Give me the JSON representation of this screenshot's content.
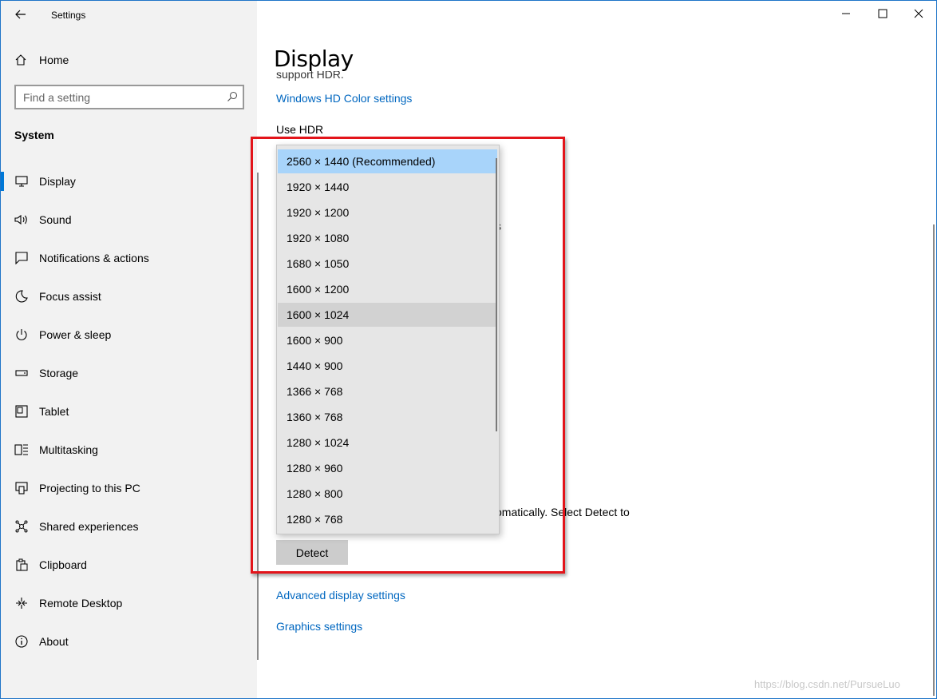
{
  "window": {
    "app_title": "Settings",
    "controls": [
      "minimize-icon",
      "maximize-icon",
      "close-icon"
    ]
  },
  "sidebar": {
    "home_label": "Home",
    "search_placeholder": "Find a setting",
    "section_title": "System",
    "items": [
      {
        "label": "Display",
        "icon": "monitor-icon",
        "active": true
      },
      {
        "label": "Sound",
        "icon": "speaker-icon"
      },
      {
        "label": "Notifications & actions",
        "icon": "notification-icon"
      },
      {
        "label": "Focus assist",
        "icon": "moon-icon"
      },
      {
        "label": "Power & sleep",
        "icon": "power-icon"
      },
      {
        "label": "Storage",
        "icon": "storage-icon"
      },
      {
        "label": "Tablet",
        "icon": "tablet-icon"
      },
      {
        "label": "Multitasking",
        "icon": "multitasking-icon"
      },
      {
        "label": "Projecting to this PC",
        "icon": "projecting-icon"
      },
      {
        "label": "Shared experiences",
        "icon": "shared-icon"
      },
      {
        "label": "Clipboard",
        "icon": "clipboard-icon"
      },
      {
        "label": "Remote Desktop",
        "icon": "remote-desktop-icon"
      },
      {
        "label": "About",
        "icon": "info-icon"
      }
    ]
  },
  "main": {
    "page_title": "Display",
    "clipped_text": "support HDR.",
    "hd_color_link": "Windows HD Color settings",
    "use_hdr_label": "Use HDR",
    "partial_s": "s",
    "partial_detect_text": "omatically. Select Detect to",
    "detect_button": "Detect",
    "advanced_link": "Advanced display settings",
    "graphics_link": "Graphics settings"
  },
  "resolution_dropdown": {
    "selected": "2560 × 1440 (Recommended)",
    "hovered": "1600 × 1024",
    "options": [
      "2560 × 1440 (Recommended)",
      "1920 × 1440",
      "1920 × 1200",
      "1920 × 1080",
      "1680 × 1050",
      "1600 × 1200",
      "1600 × 1024",
      "1600 × 900",
      "1440 × 900",
      "1366 × 768",
      "1360 × 768",
      "1280 × 1024",
      "1280 × 960",
      "1280 × 800",
      "1280 × 768"
    ]
  },
  "watermark": "https://blog.csdn.net/PursueLuo",
  "colors": {
    "accent": "#0078d7",
    "link": "#0067c0",
    "selected_option": "#a8d4fa",
    "highlight_box": "#e3141a",
    "sidebar_bg": "#f2f2f2"
  }
}
